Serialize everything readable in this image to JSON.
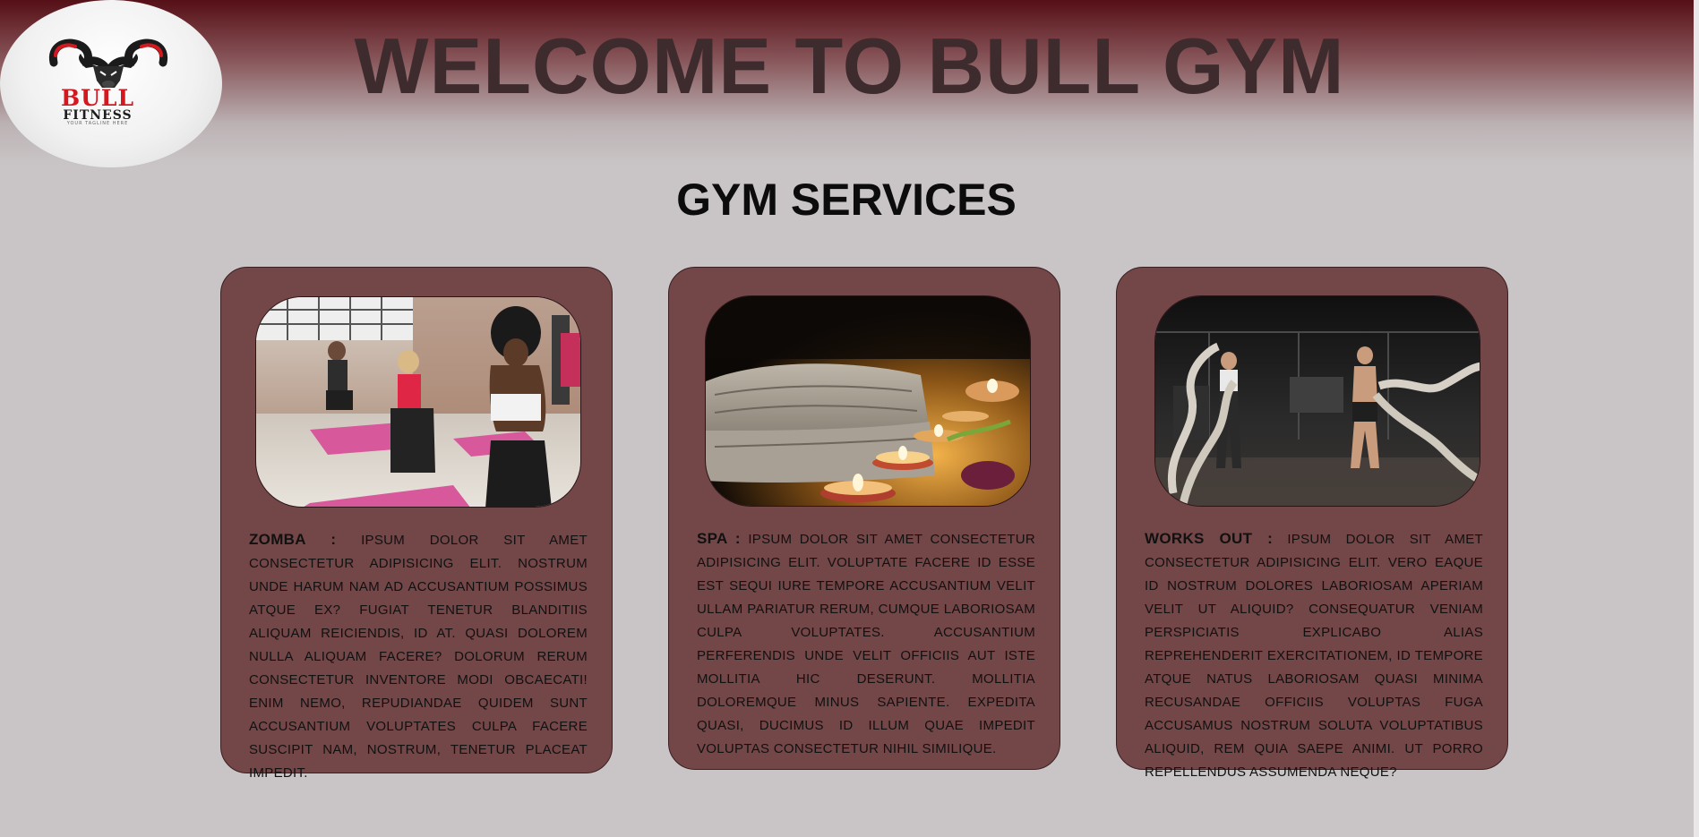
{
  "header": {
    "title": "WELCOME TO BULL GYM",
    "logo": {
      "icon": "bull-head-logo",
      "brand": "BULL",
      "sub": "FITNESS",
      "tagline": "YOUR TAGLINE HERE"
    }
  },
  "services": {
    "heading": "GYM SERVICES",
    "cards": [
      {
        "label": "ZOMBA :",
        "text": "Ipsum dolor sit amet consectetur adipisicing elit. Nostrum unde harum nam ad accusantium possimus atque ex? Fugiat tenetur blanditiis aliquam reiciendis, id at. Quasi dolorem nulla aliquam facere? Dolorum rerum consectetur inventore modi obcaecati! Enim nemo, repudiandae quidem sunt accusantium voluptates culpa facere suscipit nam, nostrum, tenetur placeat impedit.",
        "image": "zumba-class-photo"
      },
      {
        "label": "SPA :",
        "text": "Ipsum dolor sit amet consectetur adipisicing elit. Voluptate facere id esse est sequi iure tempore accusantium velit ullam pariatur rerum, cumque laboriosam culpa voluptates. Accusantium perferendis unde velit officiis aut iste mollitia hic deserunt. Mollitia doloremque minus sapiente. Expedita quasi, ducimus id illum quae impedit voluptas consectetur nihil similique.",
        "image": "spa-candles-towel-photo"
      },
      {
        "label": "WORKS OUT :",
        "text": "Ipsum dolor sit amet consectetur adipisicing elit. Vero eaque id nostrum dolores laboriosam aperiam velit ut aliquid? Consequatur veniam perspiciatis explicabo alias reprehenderit exercitationem, id tempore atque natus laboriosam quasi minima recusandae officiis voluptas fuga accusamus nostrum soluta voluptatibus aliquid, rem quia saepe animi. Ut porro repellendus assumenda neque?",
        "image": "battle-ropes-workout-photo"
      }
    ]
  },
  "colors": {
    "background": "#c9c5c6",
    "header_top": "#560f16",
    "card": "#734648",
    "title_text": "#3d2b2d",
    "logo_red": "#d4181f"
  }
}
